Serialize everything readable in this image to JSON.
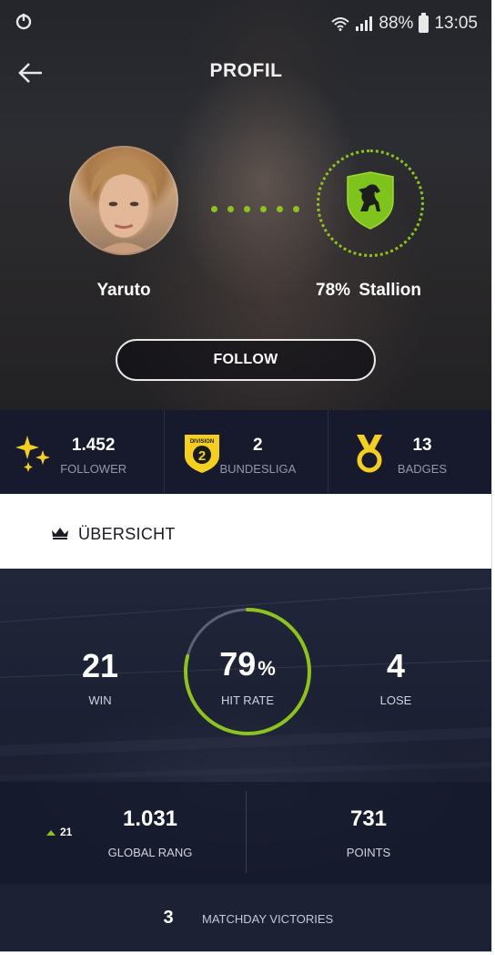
{
  "status_bar": {
    "battery": "88%",
    "time": "13:05"
  },
  "header": {
    "title": "PROFIL"
  },
  "profile": {
    "user_name": "Yaruto",
    "team_match": "78%",
    "team_name": "Stallion",
    "follow_label": "FOLLOW"
  },
  "stats": [
    {
      "value": "1.452",
      "label": "FOLLOWER",
      "icon": "sparkles-icon"
    },
    {
      "value": "2",
      "label": "BUNDESLIGA",
      "icon": "division-badge-icon",
      "badge_top": "DIVISION",
      "badge_num": "2"
    },
    {
      "value": "13",
      "label": "BADGES",
      "icon": "medal-icon"
    }
  ],
  "overview": {
    "title": "ÜBERSICHT",
    "icon": "crown-icon"
  },
  "results": {
    "win_value": "21",
    "win_label": "WIN",
    "hit_rate_value": "79",
    "hit_rate_unit": "%",
    "hit_rate_label": "HIT RATE",
    "hit_rate_fraction": 0.79,
    "lose_value": "4",
    "lose_label": "LOSE"
  },
  "ranking": {
    "rank_change": "21",
    "global_rank_value": "1.031",
    "global_rank_label": "GLOBAL RANG",
    "points_value": "731",
    "points_label": "POINTS"
  },
  "victories": {
    "value": "3",
    "label": "MATCHDAY VICTORIES"
  },
  "colors": {
    "accent": "#8ec21f",
    "gold": "#f3cf22",
    "strip_bg": "#171a2d"
  }
}
